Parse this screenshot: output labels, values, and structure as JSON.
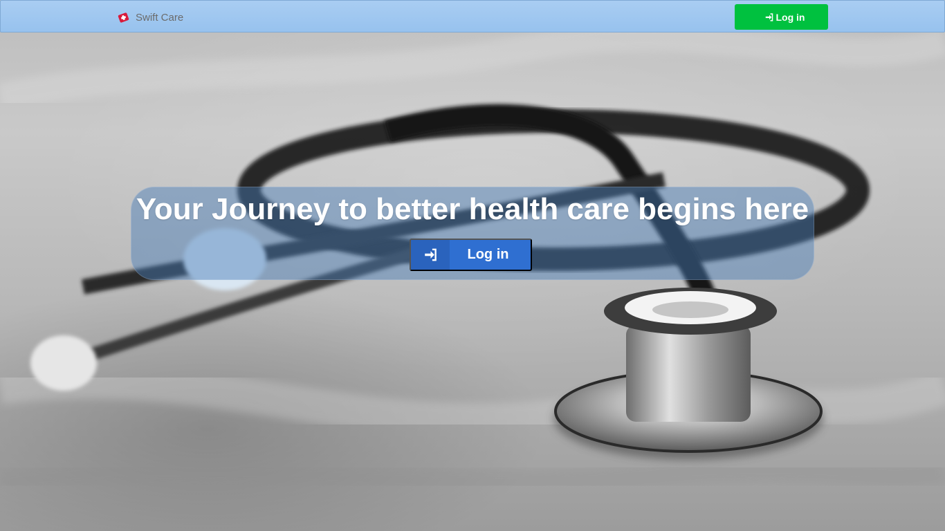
{
  "navbar": {
    "brand_name": "Swift Care",
    "brand_icon": "medical-cross-icon",
    "login_label": "Log in",
    "login_icon": "sign-in-icon",
    "login_color": "#00c13f",
    "background_color": "#97c2ee"
  },
  "hero": {
    "title": "Your Journey to better health care begins here",
    "login_label": "Log in",
    "login_icon": "sign-in-icon",
    "login_color": "#2f6fd1",
    "background_image": "stethoscope-photo"
  }
}
